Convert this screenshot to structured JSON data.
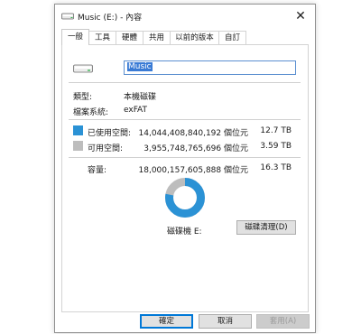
{
  "window": {
    "title": "Music (E:) - 內容"
  },
  "tabs": [
    {
      "label": "一般"
    },
    {
      "label": "工具"
    },
    {
      "label": "硬體"
    },
    {
      "label": "共用"
    },
    {
      "label": "以前的版本"
    },
    {
      "label": "自訂"
    }
  ],
  "general": {
    "name_value": "Music",
    "type_label": "類型:",
    "type_value": "本機磁碟",
    "fs_label": "檔案系統:",
    "fs_value": "exFAT",
    "used": {
      "label": "已使用空間:",
      "bytes": "14,044,408,840,192 個位元",
      "size": "12.7 TB",
      "color": "#2b92d5"
    },
    "free": {
      "label": "可用空間:",
      "bytes": "3,955,748,765,696 個位元",
      "size": "3.59 TB",
      "color": "#bdbdbd"
    },
    "capacity": {
      "label": "容量:",
      "bytes": "18,000,157,605,888 個位元",
      "size": "16.3 TB"
    },
    "drive_label": "磁碟機 E:",
    "cleanup_button": "磁碟清理(D)",
    "used_fraction": 0.7802
  },
  "buttons": {
    "ok": "確定",
    "cancel": "取消",
    "apply": "套用(A)"
  },
  "colors": {
    "accent": "#0078d7",
    "used": "#2b92d5",
    "free": "#bdbdbd"
  },
  "icons": {
    "close": "close-icon",
    "drive": "drive-icon"
  }
}
